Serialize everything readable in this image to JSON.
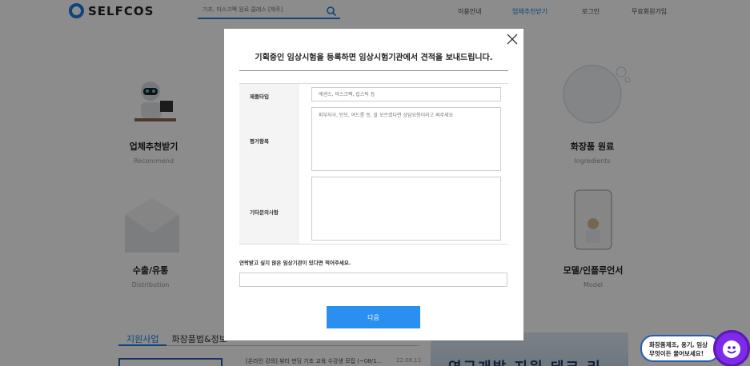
{
  "header": {
    "logo_text": "SELFCOS",
    "search_placeholder": "기초, 마스크팩 원료 클레스 [제주]",
    "nav": [
      "이용안내",
      "업체추천받기",
      "로그인",
      "무료회원가입"
    ]
  },
  "categories": [
    {
      "title": "업체추천받기",
      "subtitle": "Recommend"
    },
    {
      "title": "화장품 원료",
      "subtitle": "Ingredients"
    },
    {
      "title": "수출/유통",
      "subtitle": "Distribution"
    },
    {
      "title": "모델/인플루언서",
      "subtitle": "Model"
    }
  ],
  "tabs": [
    "지원사업",
    "화장품법&정보"
  ],
  "news": {
    "title": "[온라인 강의] 뷰티 펀딩 기초 교육 수강생 모집 (~08/1...",
    "date": "22.08.11"
  },
  "banner": {
    "text": "연구개발 지원 테크 리"
  },
  "modal": {
    "title": "기획중인 임상시험을 등록하면 임상시험기관에서 견적을 보내드립니다.",
    "rows": [
      {
        "label": "제품타입",
        "placeholder": "에센스, 마스크팩, 립스틱 등"
      },
      {
        "label": "평가항목",
        "placeholder": "피부자극, 탄모, 여드름 등, 잘 모르겠다면 상담요청이라고 써주세요"
      },
      {
        "label": "기타문의사항",
        "placeholder": ""
      }
    ],
    "contact_label": "연락받고 싶지 않은 임상기관이 있다면 적어주세요.",
    "contact_value": "",
    "next_label": "다음"
  },
  "chat": {
    "line1": "화장품제조, 용기, 임상",
    "line2": "무엇이든 물어보세요!"
  },
  "colors": {
    "accent": "#2b8ff0",
    "brand": "#1b7de0",
    "chat": "#7e2ae8"
  }
}
